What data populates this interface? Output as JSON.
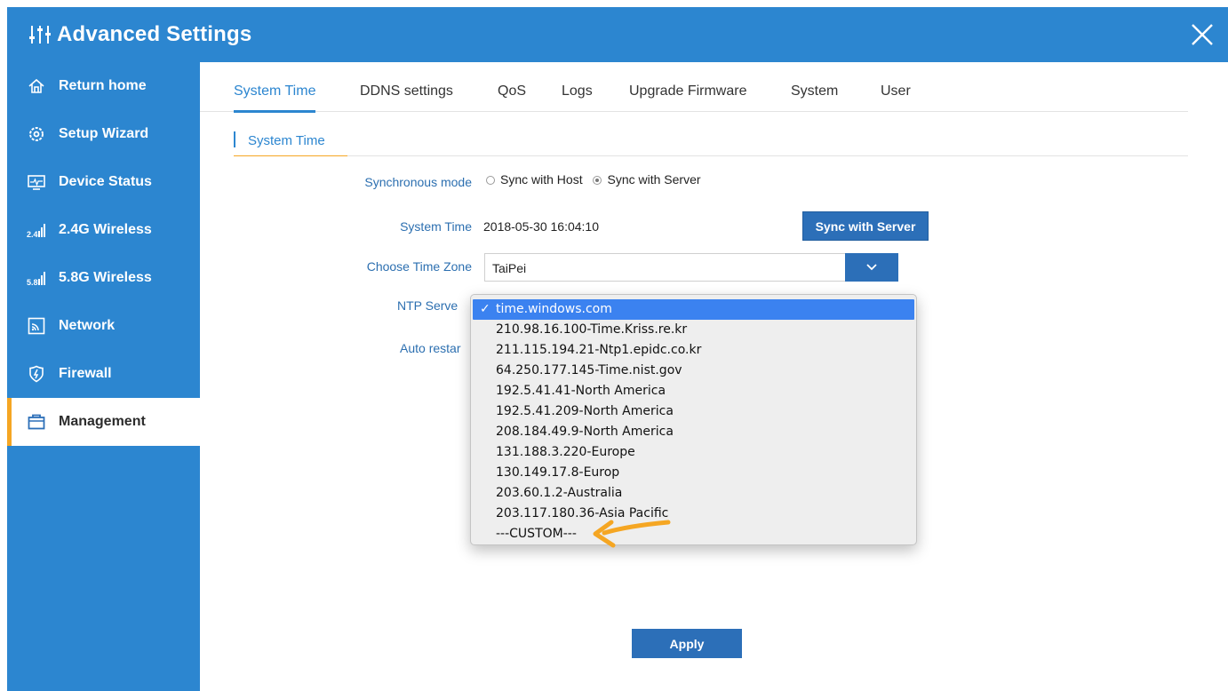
{
  "header": {
    "title": "Advanced Settings"
  },
  "colors": {
    "primary": "#2c86d0",
    "accent": "#f5a623",
    "button": "#2c6fb8",
    "dropdown_selected": "#3b82f0"
  },
  "sidebar": {
    "items": [
      {
        "label": "Return home",
        "icon": "home-icon"
      },
      {
        "label": "Setup Wizard",
        "icon": "gear-icon"
      },
      {
        "label": "Device Status",
        "icon": "monitor-icon"
      },
      {
        "label": "2.4G Wireless",
        "icon": "signal-24g-icon"
      },
      {
        "label": "5.8G Wireless",
        "icon": "signal-58g-icon"
      },
      {
        "label": "Network",
        "icon": "network-icon"
      },
      {
        "label": "Firewall",
        "icon": "shield-icon"
      },
      {
        "label": "Management",
        "icon": "briefcase-icon",
        "active": true
      }
    ]
  },
  "tabs": [
    "System Time",
    "DDNS settings",
    "QoS",
    "Logs",
    "Upgrade Firmware",
    "System",
    "User"
  ],
  "section": {
    "title": "System Time"
  },
  "form": {
    "sync_mode_label": "Synchronous mode",
    "sync_host_label": "Sync with Host",
    "sync_server_label": "Sync with Server",
    "sync_mode_selected": "Sync with Server",
    "system_time_label": "System Time",
    "system_time_value": "2018-05-30 16:04:10",
    "sync_button_label": "Sync with Server",
    "timezone_label": "Choose Time Zone",
    "timezone_value": "TaiPei",
    "ntp_label": "NTP Serve",
    "auto_restart_label": "Auto restar",
    "apply_label": "Apply"
  },
  "ntp_dropdown": {
    "selected": "time.windows.com",
    "check_mark": "✓",
    "options": [
      "time.windows.com",
      "210.98.16.100-Time.Kriss.re.kr",
      "211.115.194.21-Ntp1.epidc.co.kr",
      "64.250.177.145-Time.nist.gov",
      "192.5.41.41-North America",
      "192.5.41.209-North America",
      "208.184.49.9-North America",
      "131.188.3.220-Europe",
      "130.149.17.8-Europ",
      "203.60.1.2-Australia",
      "203.117.180.36-Asia Pacific",
      "---CUSTOM---"
    ]
  }
}
